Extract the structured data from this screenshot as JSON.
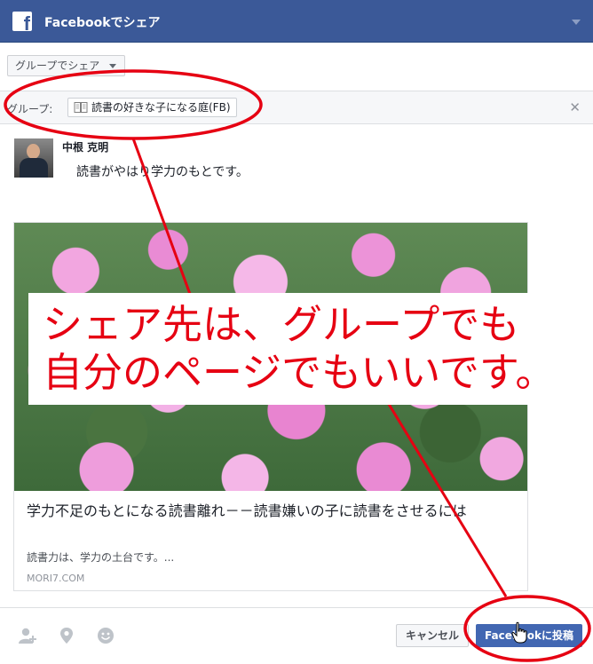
{
  "header": {
    "title": "Facebookでシェア",
    "logo_letter": "f",
    "bg_color": "#3b5998"
  },
  "share_target": {
    "selected": "グループでシェア"
  },
  "group": {
    "label": "グループ:",
    "name": "読書の好きな子になる庭(FB)",
    "remove_symbol": "✕"
  },
  "post": {
    "author": "中根 克明",
    "message": "読書がやはり学力のもとです。"
  },
  "link_preview": {
    "title": "学力不足のもとになる読書離れ－－読書嫌いの子に読書をさせるには",
    "description": "読書力は、学力の土台です。...",
    "domain": "MORI7.COM",
    "image": "pink-primrose-flowers-photo"
  },
  "footer": {
    "icons": [
      "tag-friends-icon",
      "location-pin-icon",
      "feeling-smiley-icon"
    ],
    "cancel_label": "キャンセル",
    "post_label": "Facebookに投稿",
    "post_color": "#4267b2"
  },
  "annotation": {
    "line1": "シェア先は、グループでも",
    "line2": "自分のページでもいいです。",
    "color": "#e60012"
  }
}
